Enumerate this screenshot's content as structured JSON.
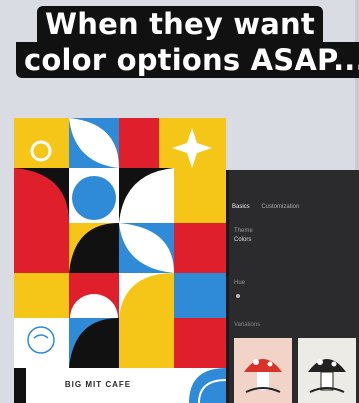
{
  "caption": {
    "line1": "When they want",
    "line2": "color options ASAP..."
  },
  "poster": {
    "label": "BIG MIT CAFE",
    "colors": {
      "yellow": "#f5c617",
      "red": "#e01f2c",
      "blue": "#2f8ad8",
      "black": "#111111",
      "white": "#ffffff"
    }
  },
  "editor": {
    "tabs": [
      "Basics",
      "Customization"
    ],
    "property_label": "Theme",
    "property_value": "Colors",
    "row_label": "Hue",
    "section_label": "Variations",
    "colors": {
      "panel": "#2b2b2d",
      "thumb1": "#f2d3c8",
      "thumb2": "#ecebe6"
    }
  }
}
